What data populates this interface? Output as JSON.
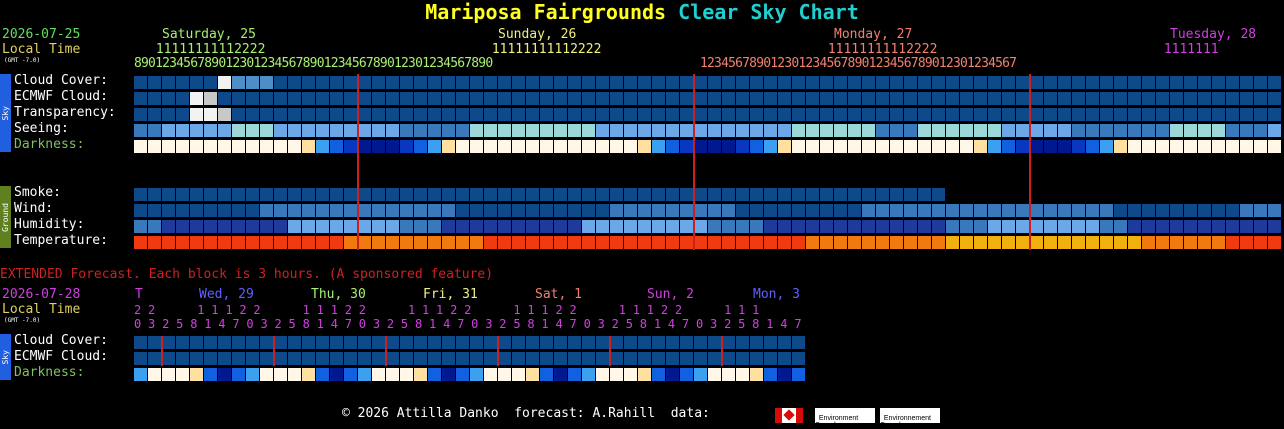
{
  "title": {
    "part1": "Mariposa Fairgrounds",
    "part2": " Clear Sky Chart"
  },
  "main": {
    "date": "2026-07-25",
    "local_time": "Local Time",
    "gmt": "(GMT -7.0)",
    "day_labels": [
      {
        "text": "Saturday, 25",
        "color": "#a8f070"
      },
      {
        "text": "Sunday, 26",
        "color": "#f0f080"
      },
      {
        "text": "Monday, 27",
        "color": "#f08070"
      },
      {
        "text": "Tuesday, 28",
        "color": "#d040e0"
      }
    ],
    "hour_tens": [
      " 11111111112222",
      " 11111111112222",
      " 11111111112222",
      " 1111111"
    ],
    "hour_ones": [
      "890123456789012301234567890123456789012301234567890",
      "123456789012301234567890123456789012301234567"
    ],
    "row_labels": {
      "cloud": "Cloud Cover:",
      "ecmwf": "ECMWF Cloud:",
      "transparency": "Transparency:",
      "seeing": "Seeing:",
      "darkness": "Darkness:",
      "smoke": "Smoke:",
      "wind": "Wind:",
      "humidity": "Humidity:",
      "temperature": "Temperature:"
    },
    "sky_tab": "Sky",
    "ground_tab": "Ground"
  },
  "extended": {
    "heading": "EXTENDED Forecast. Each block is 3 hours. (A sponsored feature)",
    "date": "2026-07-28",
    "local_time": "Local Time",
    "gmt": "(GMT -7.0)",
    "day_labels": [
      {
        "text": "T",
        "color": "#d040e0"
      },
      {
        "text": "Wed, 29",
        "color": "#6060ff"
      },
      {
        "text": "Thu, 30",
        "color": "#a8f070"
      },
      {
        "text": "Fri, 31",
        "color": "#f0f080"
      },
      {
        "text": "Sat, 1",
        "color": "#f08070"
      },
      {
        "text": "Sun, 2",
        "color": "#d040e0"
      },
      {
        "text": "Mon, 3",
        "color": "#6060ff"
      }
    ],
    "hour_tens": "2 2      1 1 1 2 2      1 1 1 2 2      1 1 1 2 2      1 1 1 2 2      1 1 1 2 2      1 1 1",
    "hour_ones": "0 3 2 5 8 1 4 7 0 3 2 5 8 1 4 7 0 3 2 5 8 1 4 7 0 3 2 5 8 1 4 7 0 3 2 5 8 1 4 7 0 3 2 5 8 1 4 7",
    "row_labels": {
      "cloud": "Cloud Cover:",
      "ecmwf": "ECMWF Cloud:",
      "darkness": "Darkness:"
    },
    "sky_tab": "Sky"
  },
  "footer": {
    "text": "© 2026 Attilla Danko  forecast: A.Rahill  data:",
    "ec_line1": "Environment",
    "ec_line2": "Canada",
    "ec_line3": "Environnement",
    "ec_line4": "Canada"
  },
  "colors": {
    "label": "#ffffff",
    "date": "#60e060",
    "local": "#e0d060",
    "darkness_label": "#80c060",
    "extended_heading": "#d02020",
    "title1": "#ffff20",
    "title2": "#20d0d0",
    "midnight_line": "#cc1f1f",
    "sky_tab": "#2060e0",
    "ground_tab": "#608020"
  },
  "chart_data": {
    "type": "table",
    "main_rows": {
      "cloud": "ddddddwbbbdddddddddddddddddddddddddddddddddddddddddddddddddddddddddddddddddddddddddddddddddddddddddddddddddd",
      "ecmwf": "ddddwgddddddddddddddddddddddddddddddddddddddddddddddddddddddddddddddddddddddddddddddddddddddddddddddddddddd",
      "transparency": "ddddwwgddddddddddddddddddddddddddddddddddddddddddddddddddddddddddddddddddddddddddddddddddddddddddddddddddddd",
      "seeing": "ppllllltttlllllllllppppptttttttttllllllllllllllttttttpppttttttlllllpppppppttttppplllttttttt",
      "smoke": "dddddddddddddddddddddddddddddddddddddddddddddddddddddddddddddddddddddddd",
      "wind": "dddddddddppppppppppppppdddddddddddpppppppppdddddddddppppppppppppppppppdddddddddppppppppppppppp",
      "humidity": "ppnnnnnnnnnllllllllpppnnnnnnnnnnlllllllllppppnnnnnnnnnnnnnpppllllllllppnnnnnnn",
      "temperature": "rrrrrrrrrrrrrrroooooooooorrrrrrrrrrrrrrrrrrrrrrrooooooooooyyyyyyyyyyyyyyoooooorrrrrrrrrrrrrrrrrrrrrrrrooooooooooooyyyyyyyyyyyyyooooooooorrrrrrrrrrr"
    },
    "extended_rows": {
      "cloud": "dddddddddddddddddddddddddddddddddddddddddddddddd",
      "ecmwf": "dddddddddddddddddddddddddddddddddddddddddddddddd"
    }
  }
}
